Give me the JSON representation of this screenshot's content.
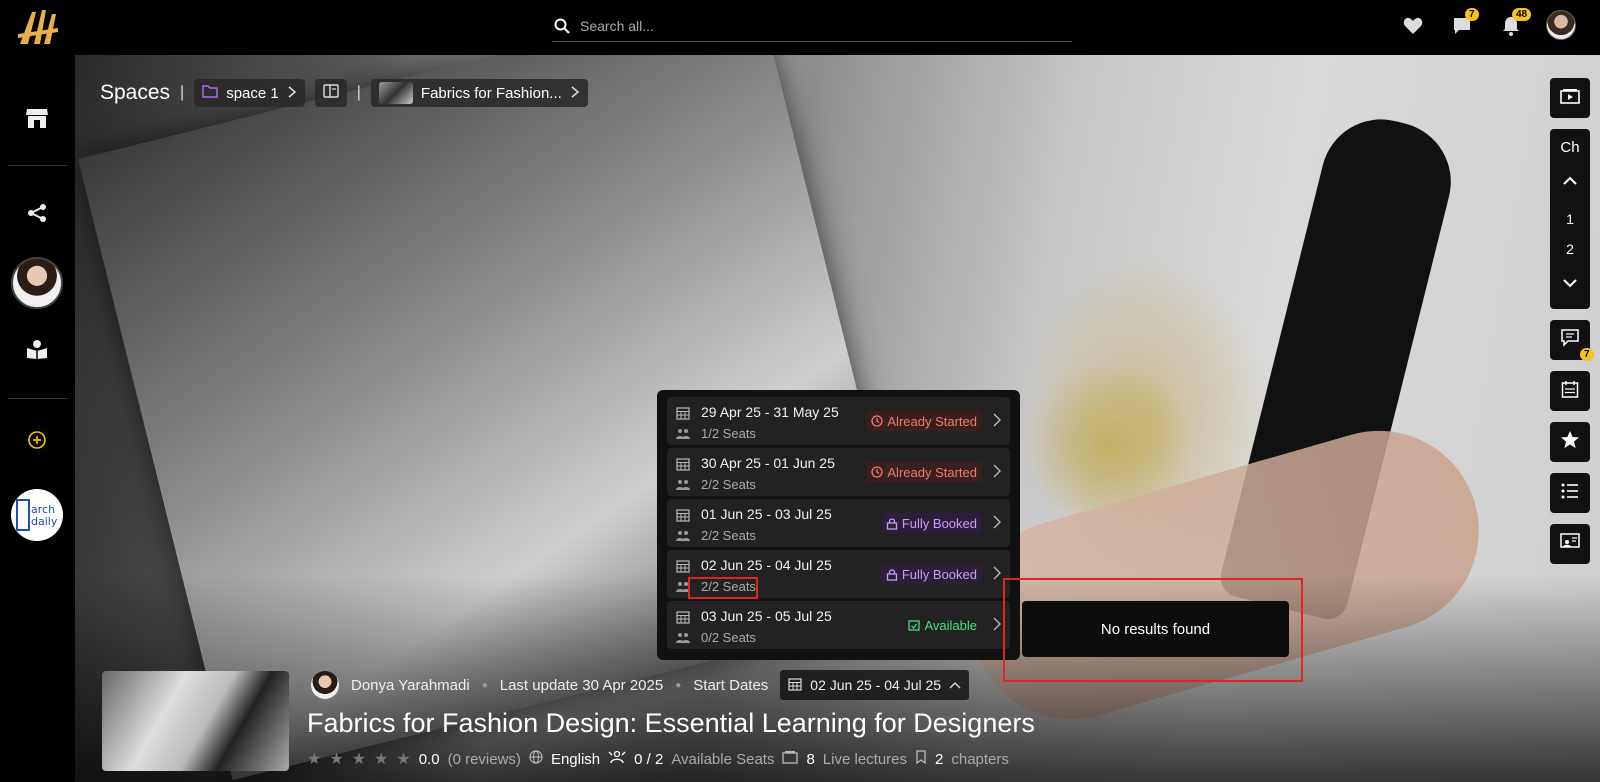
{
  "search": {
    "placeholder": "Search all..."
  },
  "header": {
    "messages_badge": "7",
    "notifications_badge": "48"
  },
  "breadcrumb": {
    "root": "Spaces",
    "space": "space 1",
    "course": "Fabrics for Fashion..."
  },
  "chapters": {
    "label": "Ch",
    "items": [
      "1",
      "2"
    ]
  },
  "right_rail": {
    "chat_badge": "7"
  },
  "start_dates": [
    {
      "range": "29 Apr 25 - 31 May 25",
      "seats": "1/2 Seats",
      "status": "Already Started",
      "kind": "started"
    },
    {
      "range": "30 Apr 25 - 01 Jun 25",
      "seats": "2/2 Seats",
      "status": "Already Started",
      "kind": "started"
    },
    {
      "range": "01 Jun 25 - 03 Jul 25",
      "seats": "2/2 Seats",
      "status": "Fully Booked",
      "kind": "booked"
    },
    {
      "range": "02 Jun 25 - 04 Jul 25",
      "seats": "2/2 Seats",
      "status": "Fully Booked",
      "kind": "booked"
    },
    {
      "range": "03 Jun 25 - 05 Jul 25",
      "seats": "0/2 Seats",
      "status": "Available",
      "kind": "available"
    }
  ],
  "no_results": "No results found",
  "course": {
    "author": "Donya Yarahmadi",
    "last_update": "Last update 30 Apr 2025",
    "start_dates_label": "Start Dates",
    "selected_date": "02 Jun 25 - 04 Jul 25",
    "title": "Fabrics for Fashion Design: Essential Learning for Designers",
    "rating": "0.0",
    "reviews": "(0 reviews)",
    "language": "English",
    "seats": "0 / 2",
    "seats_label": "Available Seats",
    "lectures": "8",
    "lectures_label": "Live lectures",
    "chapters": "2",
    "chapters_label": "chapters"
  },
  "colors": {
    "accent_yellow": "#f5c518",
    "started": "#f07a6e",
    "booked": "#c89cf7",
    "available": "#4ade80",
    "highlight_red": "#e02424"
  }
}
